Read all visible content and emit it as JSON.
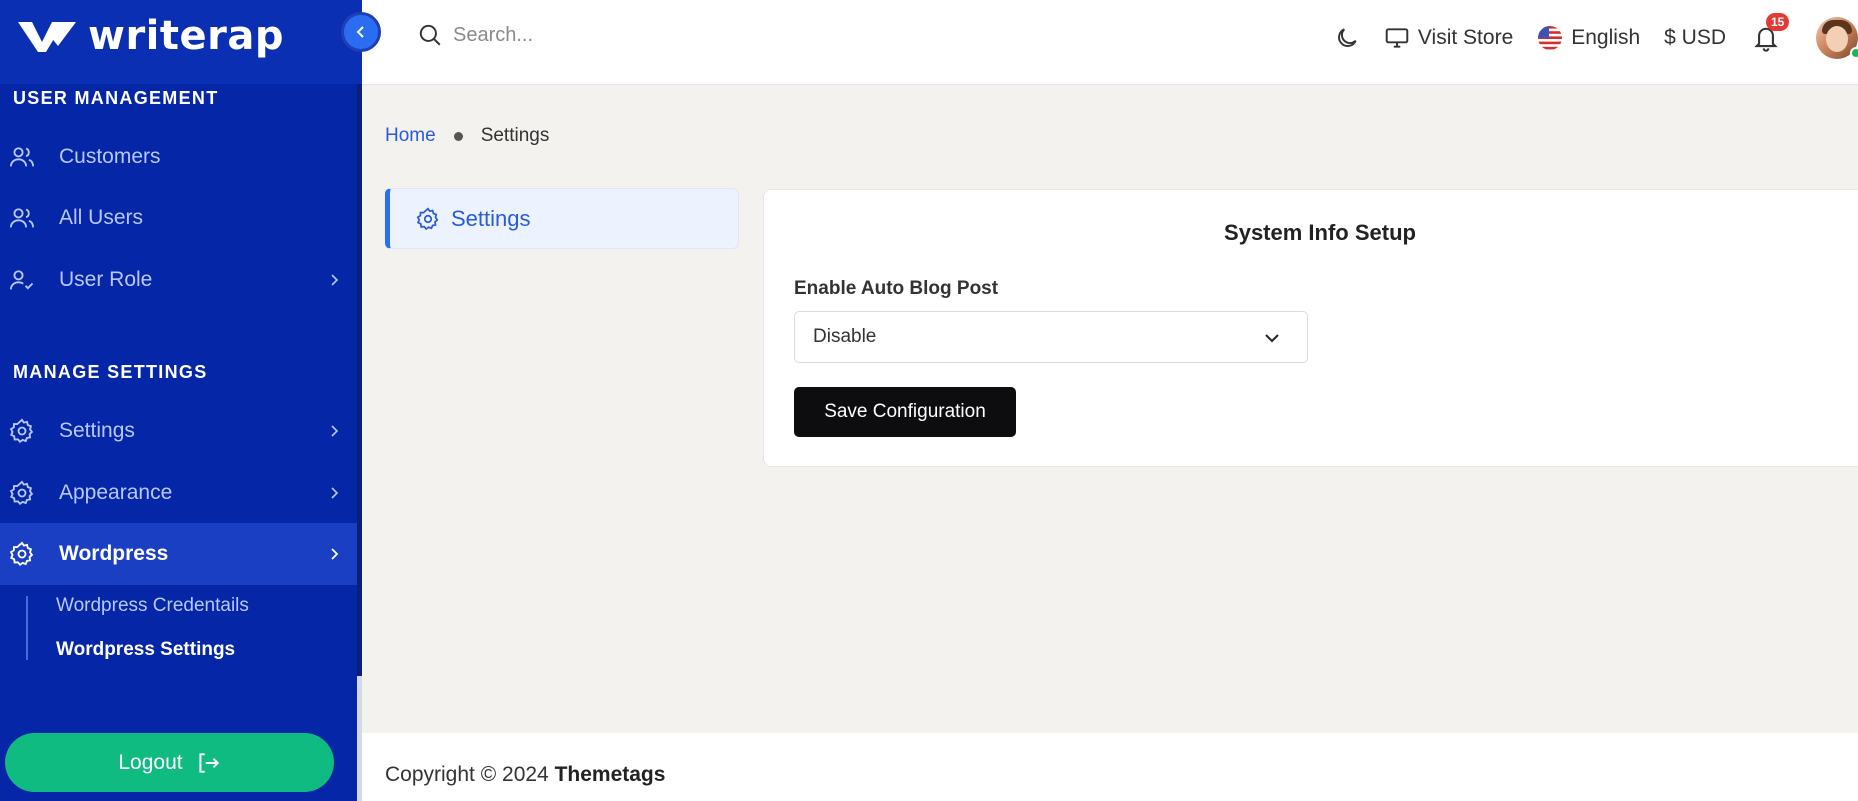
{
  "brand": {
    "name": "writerap"
  },
  "sidebar": {
    "sections": [
      {
        "title": "USER MANAGEMENT"
      },
      {
        "title": "MANAGE SETTINGS"
      }
    ],
    "items": [
      {
        "label": "Customers",
        "icon": "users-icon"
      },
      {
        "label": "All Users",
        "icon": "users-icon"
      },
      {
        "label": "User Role",
        "icon": "user-check-icon"
      },
      {
        "label": "Settings",
        "icon": "gear-icon"
      },
      {
        "label": "Appearance",
        "icon": "gear-icon"
      },
      {
        "label": "Wordpress",
        "icon": "gear-icon",
        "active": true
      }
    ],
    "subitems": [
      {
        "label": "Wordpress Credentails"
      },
      {
        "label": "Wordpress Settings",
        "current": true
      }
    ],
    "logout_label": "Logout"
  },
  "header": {
    "search_placeholder": "Search...",
    "visit_store": "Visit Store",
    "language": "English",
    "currency": "$ USD",
    "notification_count": "15"
  },
  "breadcrumb": {
    "home": "Home",
    "current": "Settings"
  },
  "settings_tab": {
    "label": "Settings"
  },
  "card": {
    "title": "System Info Setup",
    "field_label": "Enable Auto Blog Post",
    "select_value": "Disable",
    "save_label": "Save Configuration"
  },
  "footer": {
    "prefix": "Copyright © 2024 ",
    "company": "Themetags"
  },
  "colors": {
    "sidebar_bg": "#0526a6",
    "accent": "#2a6ff0",
    "logout": "#10bb82",
    "button_dark": "#0d0d0f"
  }
}
